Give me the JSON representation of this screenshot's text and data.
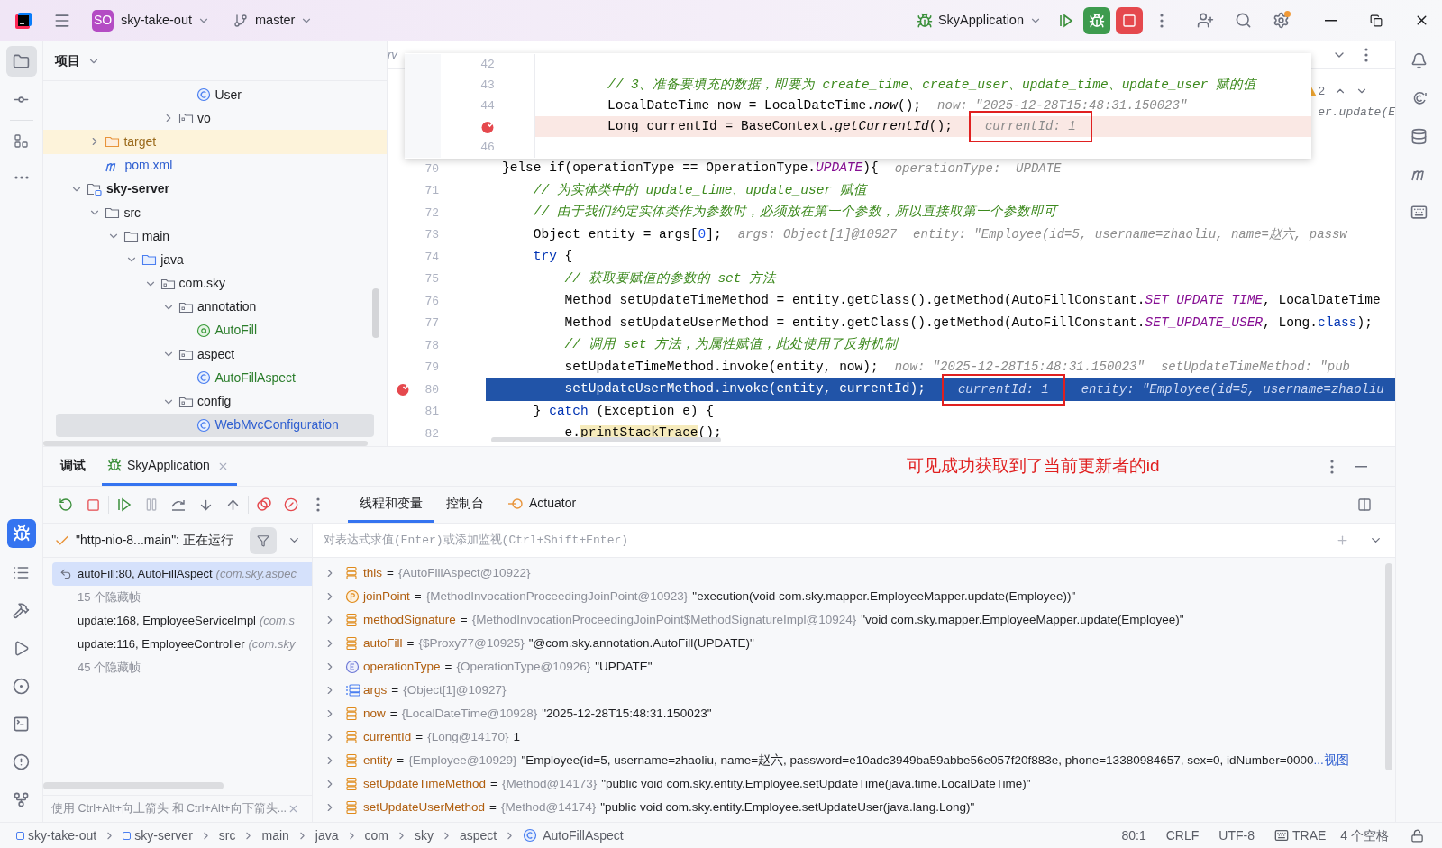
{
  "titlebar": {
    "project_badge": "SO",
    "project": "sky-take-out",
    "branch": "master",
    "run_config": "SkyApplication"
  },
  "project_panel": {
    "title": "项目",
    "tree": [
      {
        "children": [
          {
            "children": [
              {
                "children": [
                  {
                    "children": [
                      {
                        "children": [
                          {
                            "children": [
                              {
                                "label": "User",
                                "kind": "class",
                                "color": "#1e1f22",
                                "selected": false
                              }
                            ]
                          },
                          {
                            "label": "vo",
                            "kind": "package",
                            "color": "#1e1f22",
                            "expanded": false,
                            "selected": false
                          }
                        ]
                      }
                    ]
                  }
                ]
              }
            ]
          },
          {
            "label": "target",
            "kind": "excluded",
            "color": "#9a6a1c",
            "expanded": false,
            "selected": false
          },
          {
            "label": "pom.xml",
            "kind": "maven",
            "color": "#2f5fd0",
            "selected": false
          }
        ]
      },
      {
        "label": "sky-server",
        "kind": "module",
        "color": "#1e1f22",
        "bold": true,
        "expanded": true,
        "selected": false,
        "children": [
          {
            "label": "src",
            "kind": "folder",
            "color": "#1e1f22",
            "expanded": true,
            "selected": false,
            "children": [
              {
                "label": "main",
                "kind": "folder",
                "color": "#1e1f22",
                "expanded": true,
                "selected": false,
                "children": [
                  {
                    "label": "java",
                    "kind": "source",
                    "color": "#1e1f22",
                    "expanded": true,
                    "selected": false,
                    "children": [
                      {
                        "label": "com.sky",
                        "kind": "package",
                        "color": "#1e1f22",
                        "expanded": true,
                        "selected": false,
                        "children": [
                          {
                            "label": "annotation",
                            "kind": "package",
                            "color": "#1e1f22",
                            "expanded": true,
                            "selected": false,
                            "children": [
                              {
                                "label": "AutoFill",
                                "kind": "annotation",
                                "color": "#2b7d2b",
                                "selected": false
                              }
                            ]
                          },
                          {
                            "label": "aspect",
                            "kind": "package",
                            "color": "#1e1f22",
                            "expanded": true,
                            "selected": false,
                            "children": [
                              {
                                "label": "AutoFillAspect",
                                "kind": "class",
                                "color": "#2b7d2b",
                                "selected": false
                              }
                            ]
                          },
                          {
                            "label": "config",
                            "kind": "package",
                            "color": "#1e1f22",
                            "expanded": true,
                            "selected": false,
                            "children": [
                              {
                                "label": "WebMvcConfiguration",
                                "kind": "class",
                                "color": "#2f5fd0",
                                "selected": true
                              }
                            ]
                          }
                        ]
                      }
                    ]
                  }
                ]
              }
            ]
          }
        ]
      }
    ]
  },
  "editor": {
    "tab_fragment": "rv",
    "problems": "2",
    "fragment": "er.update(E",
    "popup": {
      "lines": [
        {
          "number": "42",
          "breakpoint": false,
          "current": false
        },
        {
          "number": "43",
          "breakpoint": false,
          "current": false,
          "code": [
            {
              "text": "// 3、准备要填充的数据，即要为 create_time、create_user、update_time、update_user 赋的值",
              "kind": "comment"
            }
          ]
        },
        {
          "number": "44",
          "breakpoint": false,
          "current": false,
          "code": [
            {
              "text": "LocalDateTime now = LocalDateTime.",
              "kind": "plain"
            },
            {
              "text": "now",
              "kind": "call"
            },
            {
              "text": "();",
              "kind": "plain"
            }
          ],
          "hints": [
            {
              "text": "now: \"2025-12-28T15:48:31.150023\"",
              "boxed": false
            }
          ]
        },
        {
          "breakpoint": true,
          "current": true,
          "code": [
            {
              "text": "Long currentId = BaseContext.",
              "kind": "plain"
            },
            {
              "text": "getCurrentId",
              "kind": "call"
            },
            {
              "text": "();",
              "kind": "plain"
            }
          ],
          "hints": [
            {
              "text": "currentId: 1",
              "boxed": true
            }
          ]
        },
        {
          "number": "46",
          "breakpoint": false,
          "current": false
        }
      ]
    },
    "lines": [
      {
        "number": "70",
        "breakpoint": false,
        "current": false,
        "code": [
          {
            "text": "}else if(operationType == OperationType.",
            "kind": "plain"
          },
          {
            "text": "UPDATE",
            "kind": "constant"
          },
          {
            "text": "){",
            "kind": "plain"
          }
        ],
        "hints": [
          {
            "text": "operationType:  UPDATE",
            "boxed": false
          }
        ]
      },
      {
        "number": "71",
        "breakpoint": false,
        "current": false,
        "code": [
          {
            "text": "    // 为实体类中的 update_time、update_user 赋值",
            "kind": "comment"
          }
        ]
      },
      {
        "number": "72",
        "breakpoint": false,
        "current": false,
        "code": [
          {
            "text": "    // 由于我们约定实体类作为参数时，必须放在第一个参数，所以直接取第一个参数即可",
            "kind": "comment"
          }
        ]
      },
      {
        "number": "73",
        "breakpoint": false,
        "current": false,
        "code": [
          {
            "text": "    Object entity = args[",
            "kind": "plain"
          },
          {
            "text": "0",
            "kind": "number"
          },
          {
            "text": "];",
            "kind": "plain"
          }
        ],
        "hints": [
          {
            "text": "args: Object[1]@10927",
            "boxed": false
          },
          {
            "text": "entity: \"Employee(id=5, username=zhaoliu, name=赵六, passw",
            "boxed": false
          }
        ]
      },
      {
        "number": "74",
        "breakpoint": false,
        "current": false,
        "code": [
          {
            "text": "    try",
            "kind": "keyword"
          },
          {
            "text": " {",
            "kind": "plain"
          }
        ]
      },
      {
        "number": "75",
        "breakpoint": false,
        "current": false,
        "code": [
          {
            "text": "        // 获取要赋值的参数的 set 方法",
            "kind": "comment"
          }
        ]
      },
      {
        "number": "76",
        "breakpoint": false,
        "current": false,
        "code": [
          {
            "text": "        Method setUpdateTimeMethod = entity.getClass().getMethod(AutoFillConstant.",
            "kind": "plain"
          },
          {
            "text": "SET_UPDATE_TIME",
            "kind": "constant"
          },
          {
            "text": ", LocalDateTime",
            "kind": "plain"
          }
        ]
      },
      {
        "number": "77",
        "breakpoint": false,
        "current": false,
        "code": [
          {
            "text": "        Method setUpdateUserMethod = entity.getClass().getMethod(AutoFillConstant.",
            "kind": "plain"
          },
          {
            "text": "SET_UPDATE_USER",
            "kind": "constant"
          },
          {
            "text": ", Long.",
            "kind": "plain"
          },
          {
            "text": "class",
            "kind": "keyword"
          },
          {
            "text": ");",
            "kind": "plain"
          }
        ]
      },
      {
        "number": "78",
        "breakpoint": false,
        "current": false,
        "code": [
          {
            "text": "        // 调用 set 方法，为属性赋值，此处使用了反射机制",
            "kind": "comment"
          }
        ]
      },
      {
        "number": "79",
        "breakpoint": false,
        "current": false,
        "code": [
          {
            "text": "        setUpdateTimeMethod.invoke(entity, now);",
            "kind": "plain"
          }
        ],
        "hints": [
          {
            "text": "now: \"2025-12-28T15:48:31.150023\"",
            "boxed": false
          },
          {
            "text": "setUpdateTimeMethod: \"pub",
            "boxed": false
          }
        ]
      },
      {
        "number": "80",
        "breakpoint": true,
        "current": true,
        "code": [
          {
            "text": "        setUpdateUserMethod.invoke(entity, currentId);",
            "kind": "plain"
          }
        ],
        "hints": [
          {
            "text": "currentId: 1",
            "boxed": true
          },
          {
            "text": "entity: \"Employee(id=5, username=zhaoliu",
            "boxed": false
          }
        ]
      },
      {
        "number": "81",
        "breakpoint": false,
        "current": false,
        "code": [
          {
            "text": "    } ",
            "kind": "plain"
          },
          {
            "text": "catch",
            "kind": "keyword"
          },
          {
            "text": " (Exception e) {",
            "kind": "plain"
          }
        ]
      },
      {
        "number": "82",
        "breakpoint": false,
        "current": false,
        "code": [
          {
            "text": "        e.",
            "kind": "plain"
          },
          {
            "text": "printStackTrace",
            "kind": "warning"
          },
          {
            "text": "();",
            "kind": "plain"
          }
        ]
      }
    ]
  },
  "debug": {
    "tabs": [
      {
        "label": "调试",
        "selected": false,
        "kind": "title"
      },
      {
        "label": "SkyApplication",
        "selected": true,
        "kind": "session"
      }
    ],
    "note": "可见成功获取到了当前更新者的id",
    "view_tabs": [
      {
        "label": "线程和变量",
        "selected": true
      },
      {
        "label": "控制台",
        "selected": false
      },
      {
        "label": "Actuator",
        "selected": false
      }
    ],
    "thread": "\"http-nio-8...main\": 正在运行",
    "expression_placeholder": "对表达式求值(Enter)或添加监视(Ctrl+Shift+Enter)",
    "frames": [
      {
        "kind": "frame",
        "method": "autoFill:80, AutoFillAspect",
        "location": "(com.sky.aspec",
        "selected": true
      },
      {
        "kind": "hidden",
        "method": "15 个隐藏帧",
        "selected": false
      },
      {
        "kind": "frame",
        "method": "update:168, EmployeeServiceImpl",
        "location": "(com.s",
        "selected": false
      },
      {
        "kind": "frame",
        "method": "update:116, EmployeeController",
        "location": "(com.sky",
        "selected": false
      },
      {
        "kind": "hidden",
        "method": "45 个隐藏帧",
        "selected": false
      }
    ],
    "frames_hint": "使用 Ctrl+Alt+向上箭头 和 Ctrl+Alt+向下箭头...",
    "variables": [
      {
        "kind": "field",
        "name": "this",
        "equals": "=",
        "type": "{AutoFillAspect@10922}",
        "expanded": false
      },
      {
        "kind": "parameter",
        "name": "joinPoint",
        "equals": "=",
        "type": "{MethodInvocationProceedingJoinPoint@10923}",
        "value": "\"execution(void com.sky.mapper.EmployeeMapper.update(Employee))\"",
        "expanded": false
      },
      {
        "kind": "field",
        "name": "methodSignature",
        "equals": "=",
        "type": "{MethodInvocationProceedingJoinPoint$MethodSignatureImpl@10924}",
        "value": "\"void com.sky.mapper.EmployeeMapper.update(Employee)\"",
        "expanded": false
      },
      {
        "kind": "field",
        "name": "autoFill",
        "equals": "=",
        "type": "{$Proxy77@10925}",
        "value": "\"@com.sky.annotation.AutoFill(UPDATE)\"",
        "expanded": false
      },
      {
        "kind": "enum",
        "name": "operationType",
        "equals": "=",
        "type": "{OperationType@10926}",
        "value": "\"UPDATE\"",
        "expanded": false
      },
      {
        "kind": "array",
        "name": "args",
        "equals": "=",
        "type": "{Object[1]@10927}",
        "expanded": false
      },
      {
        "kind": "field",
        "name": "now",
        "equals": "=",
        "type": "{LocalDateTime@10928}",
        "value": "\"2025-12-28T15:48:31.150023\"",
        "expanded": false
      },
      {
        "kind": "field",
        "name": "currentId",
        "equals": "=",
        "type": "{Long@14170}",
        "value": "1",
        "expanded": false
      },
      {
        "kind": "field",
        "name": "entity",
        "equals": "=",
        "type": "{Employee@10929}",
        "value": "\"Employee(id=5, username=zhaoliu, name=赵六, password=e10adc3949ba59abbe56e057f20f883e, phone=13380984657, sex=0, idNumber=0000",
        "link": "...视图",
        "expanded": false
      },
      {
        "kind": "field",
        "name": "setUpdateTimeMethod",
        "equals": "=",
        "type": "{Method@14173}",
        "value": "\"public void com.sky.entity.Employee.setUpdateTime(java.time.LocalDateTime)\"",
        "expanded": false
      },
      {
        "kind": "field",
        "name": "setUpdateUserMethod",
        "equals": "=",
        "type": "{Method@14174}",
        "value": "\"public void com.sky.entity.Employee.setUpdateUser(java.lang.Long)\"",
        "expanded": false
      }
    ]
  },
  "status_bar": {
    "breadcrumbs": [
      {
        "label": "sky-take-out",
        "kind": "module"
      },
      {
        "label": "sky-server",
        "kind": "module"
      },
      {
        "label": "src",
        "kind": "plain"
      },
      {
        "label": "main",
        "kind": "plain"
      },
      {
        "label": "java",
        "kind": "plain"
      },
      {
        "label": "com",
        "kind": "plain"
      },
      {
        "label": "sky",
        "kind": "plain"
      },
      {
        "label": "aspect",
        "kind": "plain"
      },
      {
        "label": "AutoFillAspect",
        "kind": "class"
      }
    ],
    "position": "80:1",
    "line_ending": "CRLF",
    "encoding": "UTF-8",
    "assistant": "TRAE",
    "indent": "4 个空格"
  }
}
